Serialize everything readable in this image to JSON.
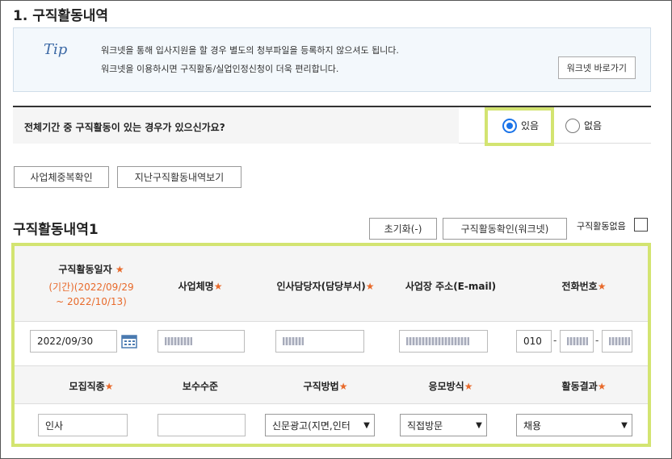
{
  "section": {
    "title": "1. 구직활동내역"
  },
  "tip": {
    "label": "Tip",
    "line1": "워크넷을 통해 입사지원을 할 경우 별도의 청부파일을 등록하지 않으셔도 됩니다.",
    "line2": "워크넷을 이용하시면 구직활동/실업인정신청이 더욱 편리합니다.",
    "worknet_button": "워크넷 바로가기"
  },
  "question": {
    "text": "전체기간 중 구직활동이 있는 경우가 있으신가요?",
    "options": [
      {
        "label": "있음",
        "checked": true
      },
      {
        "label": "없음",
        "checked": false
      }
    ]
  },
  "buttons": {
    "duplicate_check": "사업체중복확인",
    "past_history": "지난구직활동내역보기",
    "reset": "초기화(-)",
    "worknet_confirm": "구직활동확인(워크넷)"
  },
  "list": {
    "title": "구직활동내역1",
    "none_label": "구직활동없음"
  },
  "table": {
    "headers_row1": {
      "date": "구직활동일자",
      "date_period_line1": "(기간)(2022/09/29",
      "date_period_line2": "~ 2022/10/13)",
      "company": "사업체명",
      "manager": "인사담당자(담당부서)",
      "address": "사업장 주소(E-mail)",
      "phone": "전화번호"
    },
    "required_mark": "★",
    "row1": {
      "date": "2022/09/30",
      "phone_prefix": "010",
      "phone_dash": "-"
    },
    "headers_row2": {
      "job": "모집직종",
      "salary": "보수수준",
      "method": "구직방법",
      "apply": "응모방식",
      "result": "활동결과"
    },
    "row2": {
      "job": "인사",
      "salary": "",
      "method": "신문광고(지면,인터",
      "apply": "직접방문",
      "result": "채용"
    }
  },
  "colors": {
    "accent": "#1a73e8",
    "required": "#e86a2b",
    "highlight": "#d3e471"
  }
}
